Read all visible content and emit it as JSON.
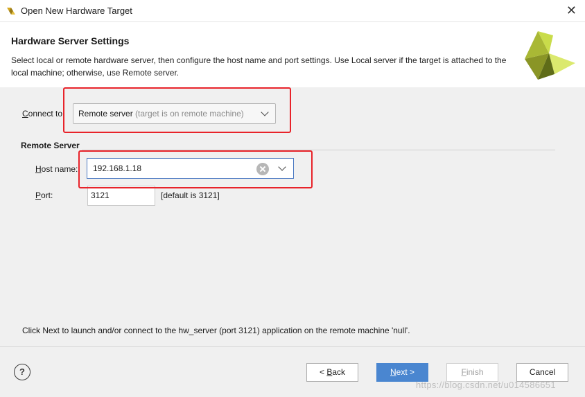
{
  "window": {
    "title": "Open New Hardware Target",
    "close_icon": "close-x-icon"
  },
  "header": {
    "title": "Hardware Server Settings",
    "description": "Select local or remote hardware server, then configure the host name and port settings. Use Local server if the target is attached to the local machine; otherwise, use Remote server.",
    "logo": "vivado-logo",
    "colors": {
      "logo_yellow": "#d6e85a",
      "logo_olive": "#8f9a2c",
      "logo_dark": "#5d6b18"
    }
  },
  "connect": {
    "label_prefix": "C",
    "label_rest": "onnect to:",
    "selected": "Remote server",
    "selected_hint": "(target is on remote machine)"
  },
  "remote_server": {
    "section_title": "Remote Server",
    "host_label_prefix": "H",
    "host_label_rest": "ost name:",
    "host_value": "192.168.1.18",
    "port_label_prefix": "P",
    "port_label_rest": "ort:",
    "port_value": "3121",
    "port_default": "[default is 3121]"
  },
  "footer_note": "Click Next to launch and/or connect to the hw_server (port 3121) application on the remote machine 'null'.",
  "buttons": {
    "help": "?",
    "back_prefix": "< ",
    "back_u": "B",
    "back_rest": "ack",
    "next_u": "N",
    "next_rest": "ext >",
    "finish_u": "F",
    "finish_rest": "inish",
    "cancel": "Cancel"
  },
  "watermark": "https://blog.csdn.net/u014586651",
  "highlight_color": "#e8232a",
  "accent_color": "#4a86d0"
}
